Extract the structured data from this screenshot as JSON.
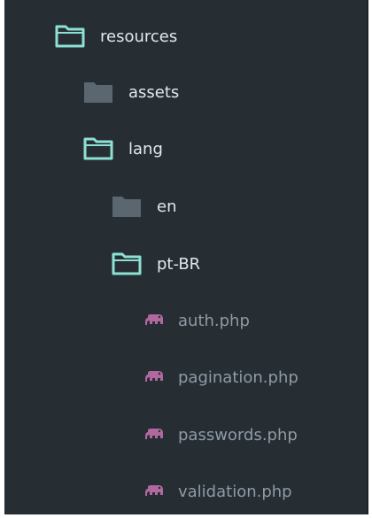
{
  "tree": {
    "items": [
      {
        "label": "resources",
        "kind": "folder",
        "state": "open",
        "icon": "folder-open-icon"
      },
      {
        "label": "assets",
        "kind": "folder",
        "state": "closed",
        "icon": "folder-closed-icon"
      },
      {
        "label": "lang",
        "kind": "folder",
        "state": "open",
        "icon": "folder-open-icon"
      },
      {
        "label": "en",
        "kind": "folder",
        "state": "closed",
        "icon": "folder-closed-icon"
      },
      {
        "label": "pt-BR",
        "kind": "folder",
        "state": "open",
        "icon": "folder-open-icon"
      },
      {
        "label": "auth.php",
        "kind": "file",
        "icon": "php-elephant-icon"
      },
      {
        "label": "pagination.php",
        "kind": "file",
        "icon": "php-elephant-icon"
      },
      {
        "label": "passwords.php",
        "kind": "file",
        "icon": "php-elephant-icon"
      },
      {
        "label": "validation.php",
        "kind": "file",
        "icon": "php-elephant-icon"
      }
    ]
  },
  "colors": {
    "background": "#262e34",
    "open_folder": "#8ee0d3",
    "closed_folder": "#5a6670",
    "php_icon": "#b0689e",
    "folder_text": "#e3e8ec",
    "file_text": "#8f9aa4"
  }
}
